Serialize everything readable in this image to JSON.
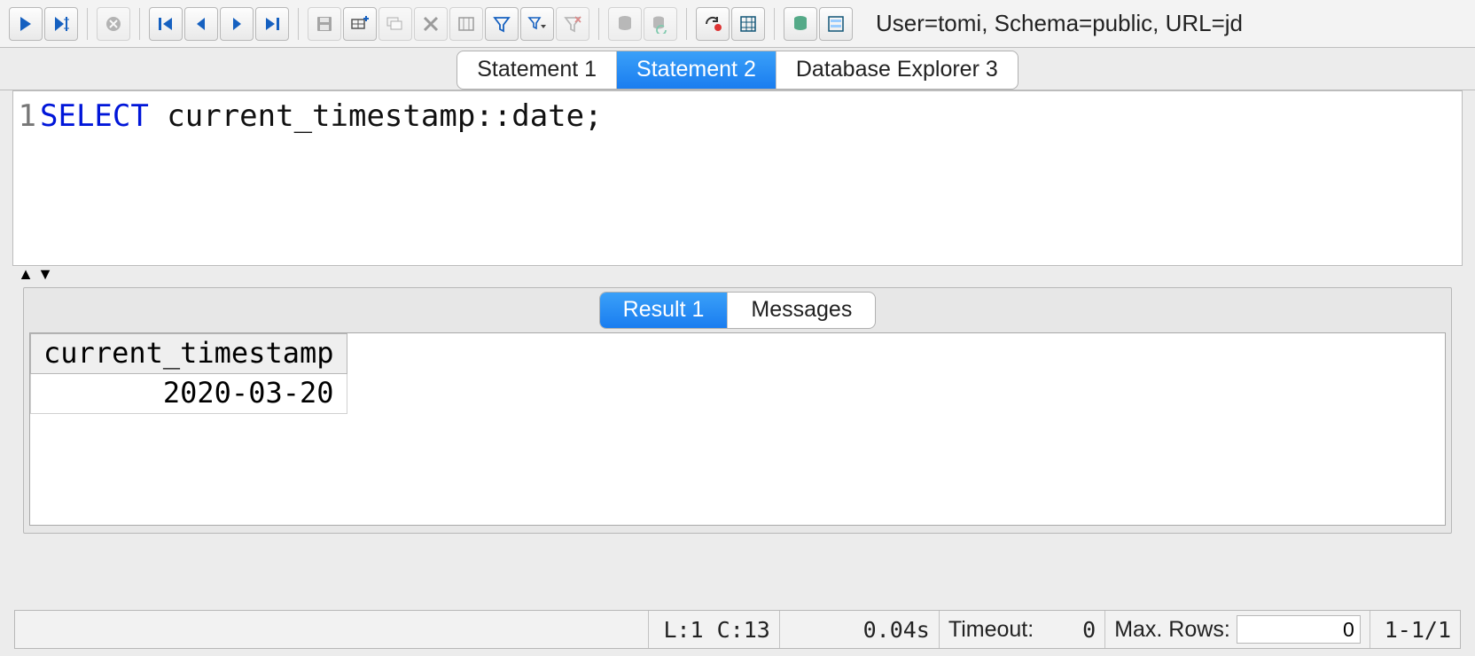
{
  "toolbar": {
    "buttons": [
      {
        "name": "run-icon",
        "disabled": false,
        "svg": "play"
      },
      {
        "name": "run-to-cursor-icon",
        "disabled": false,
        "svg": "playcursor"
      },
      {
        "sep": true
      },
      {
        "name": "stop-icon",
        "disabled": true,
        "svg": "stop"
      },
      {
        "sep": true
      },
      {
        "name": "first-record-icon",
        "disabled": false,
        "svg": "first"
      },
      {
        "name": "prev-record-icon",
        "disabled": false,
        "svg": "prev"
      },
      {
        "name": "next-record-icon",
        "disabled": false,
        "svg": "next"
      },
      {
        "name": "last-record-icon",
        "disabled": false,
        "svg": "last"
      },
      {
        "sep": true
      },
      {
        "name": "save-icon",
        "disabled": true,
        "svg": "floppy"
      },
      {
        "name": "insert-row-icon",
        "disabled": false,
        "svg": "insrow"
      },
      {
        "name": "copy-row-icon",
        "disabled": true,
        "svg": "cprow"
      },
      {
        "name": "delete-row-icon",
        "disabled": true,
        "svg": "delrow"
      },
      {
        "name": "columns-icon",
        "disabled": true,
        "svg": "columns"
      },
      {
        "name": "filter-icon",
        "disabled": false,
        "svg": "filter"
      },
      {
        "name": "filter-dropdown-icon",
        "disabled": false,
        "svg": "filterdd"
      },
      {
        "name": "clear-filter-icon",
        "disabled": true,
        "svg": "clearfilter"
      },
      {
        "sep": true
      },
      {
        "name": "db-icon",
        "disabled": true,
        "svg": "db"
      },
      {
        "name": "db-refresh-icon",
        "disabled": true,
        "svg": "dbref"
      },
      {
        "sep": true
      },
      {
        "name": "reconnect-icon",
        "disabled": false,
        "svg": "reconnect"
      },
      {
        "name": "grid-settings-icon",
        "disabled": false,
        "svg": "gridset"
      },
      {
        "sep": true
      },
      {
        "name": "db-storage-icon",
        "disabled": false,
        "svg": "dbstore"
      },
      {
        "name": "form-view-icon",
        "disabled": false,
        "svg": "formview"
      }
    ],
    "conn_info": "User=tomi, Schema=public, URL=jd"
  },
  "top_tabs": [
    {
      "label": "Statement 1",
      "active": false
    },
    {
      "label": "Statement 2",
      "active": true
    },
    {
      "label": "Database Explorer 3",
      "active": false
    }
  ],
  "editor": {
    "line_number": "1",
    "sql_keyword": "SELECT",
    "sql_rest": " current_timestamp::date;"
  },
  "splitter": {
    "up": "▲",
    "down": "▼"
  },
  "result_tabs": [
    {
      "label": "Result 1",
      "active": true
    },
    {
      "label": "Messages",
      "active": false
    }
  ],
  "grid": {
    "columns": [
      "current_timestamp"
    ],
    "rows": [
      [
        "2020-03-20"
      ]
    ]
  },
  "status": {
    "cursor": "L:1 C:13",
    "elapsed": "0.04s",
    "timeout_label": "Timeout:",
    "timeout_value": "0",
    "maxrows_label": "Max. Rows:",
    "maxrows_value": "0",
    "range": "1-1/1"
  }
}
